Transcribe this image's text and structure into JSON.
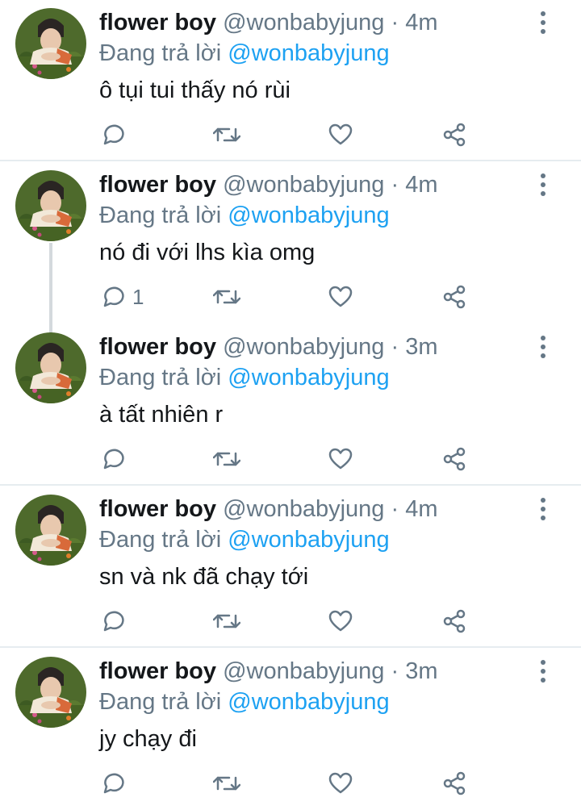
{
  "colors": {
    "name": "#14171a",
    "secondary": "#657786",
    "mention": "#1da1f2",
    "icon": "#657786",
    "divider": "#e6ecf0",
    "thread_line": "#d4d9dd"
  },
  "tweets": [
    {
      "name": "flower boy",
      "handle": "@wonbabyjung",
      "dot": "·",
      "time": "4m",
      "reply_prefix": "Đang trả lời",
      "reply_to": "@wonbabyjung",
      "text": "ô tụi tui thấy nó rùi",
      "reply_count": ""
    },
    {
      "name": "flower boy",
      "handle": "@wonbabyjung",
      "dot": "·",
      "time": "4m",
      "reply_prefix": "Đang trả lời",
      "reply_to": "@wonbabyjung",
      "text": "nó đi với lhs kìa omg",
      "reply_count": "1"
    },
    {
      "name": "flower boy",
      "handle": "@wonbabyjung",
      "dot": "·",
      "time": "3m",
      "reply_prefix": "Đang trả lời",
      "reply_to": "@wonbabyjung",
      "text": "à tất nhiên r",
      "reply_count": ""
    },
    {
      "name": "flower boy",
      "handle": "@wonbabyjung",
      "dot": "·",
      "time": "4m",
      "reply_prefix": "Đang trả lời",
      "reply_to": "@wonbabyjung",
      "text": "sn và nk đã chạy tới",
      "reply_count": ""
    },
    {
      "name": "flower boy",
      "handle": "@wonbabyjung",
      "dot": "·",
      "time": "3m",
      "reply_prefix": "Đang trả lời",
      "reply_to": "@wonbabyjung",
      "text": "jy chạy đi",
      "reply_count": ""
    }
  ],
  "icons": {
    "avatar": "avatar-photo",
    "more": "more-vertical-icon",
    "reply": "reply-icon",
    "retweet": "retweet-icon",
    "like": "heart-icon",
    "share": "share-icon"
  }
}
